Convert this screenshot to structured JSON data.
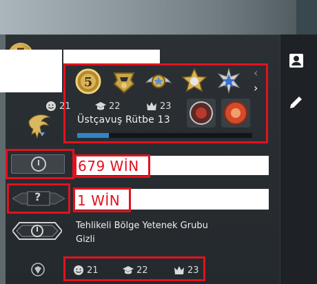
{
  "profile": {
    "rank_name": "Üstçavuş Rütbe 13",
    "xp_progress": 0.18,
    "friendly_count": "21",
    "teacher_count": "22",
    "leader_count": "23"
  },
  "medals": {
    "avatar_badge": "5",
    "medal_1_badge": "5"
  },
  "wingman": {
    "wins": "679 WİN"
  },
  "danger_zone": {
    "wins": "1 WİN",
    "unknown_glyph": "?"
  },
  "skill_group": {
    "label": "Tehlikeli Bölge Yetenek Grubu",
    "value": "Gizli"
  },
  "footer_commends": {
    "friendly_count": "21",
    "teacher_count": "22",
    "leader_count": "23"
  },
  "nav": {
    "prev_glyph": "‹",
    "next_glyph": "›"
  },
  "colors": {
    "highlight": "#e2121e",
    "xp_fill": "#2f86c7",
    "panel_bg": "#24292d"
  },
  "icons": [
    "profile-card-icon",
    "pencil-icon",
    "smiley-icon",
    "graduation-cap-icon",
    "crown-icon",
    "clock-icon",
    "question-mark-icon",
    "eagle-rank-icon"
  ]
}
